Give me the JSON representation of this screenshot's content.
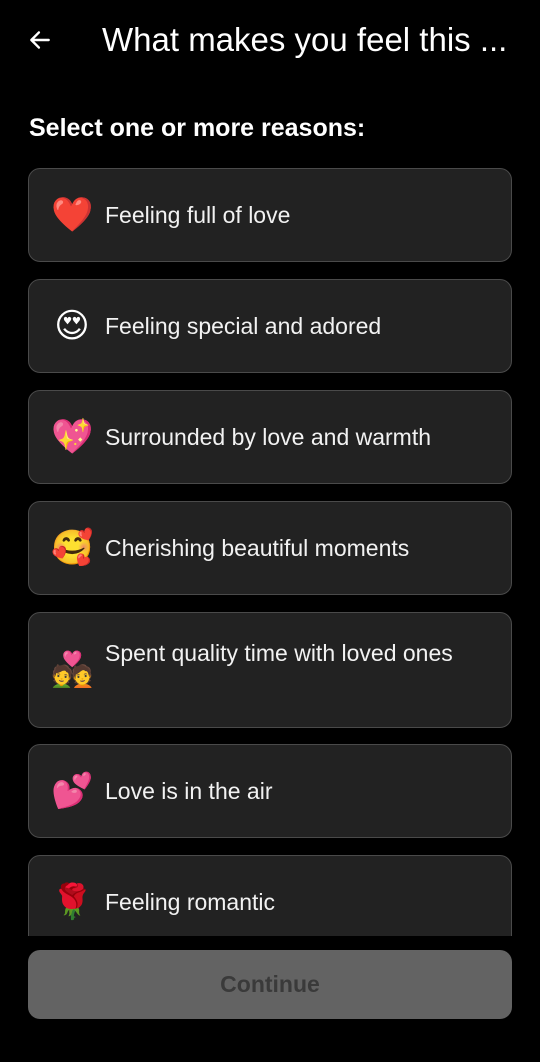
{
  "header": {
    "back_icon": "arrow-left-icon",
    "title": "What makes you feel this ..."
  },
  "prompt": "Select one or more reasons:",
  "options": [
    {
      "emoji": "❤️",
      "icon": "red-heart-icon",
      "label": "Feeling full of love"
    },
    {
      "emoji": "😍",
      "icon": "heart-eyes-face-icon",
      "label": "Feeling special and adored"
    },
    {
      "emoji": "💖",
      "icon": "sparkling-heart-icon",
      "label": "Surrounded by love and warmth"
    },
    {
      "emoji": "🥰",
      "icon": "smiling-face-with-hearts-icon",
      "label": "Cherishing beautiful moments"
    },
    {
      "emoji": "💑",
      "icon": "couple-with-heart-icon",
      "label": "Spent quality time with loved ones"
    },
    {
      "emoji": "💕",
      "icon": "two-hearts-icon",
      "label": "Love is in the air"
    },
    {
      "emoji": "🌹",
      "icon": "rose-icon",
      "label": "Feeling romantic"
    }
  ],
  "continue_label": "Continue",
  "colors": {
    "background": "#000000",
    "card": "#222222",
    "card_border": "#4a4a4a",
    "button_disabled": "#636363",
    "button_text_disabled": "#3a3a3a"
  }
}
